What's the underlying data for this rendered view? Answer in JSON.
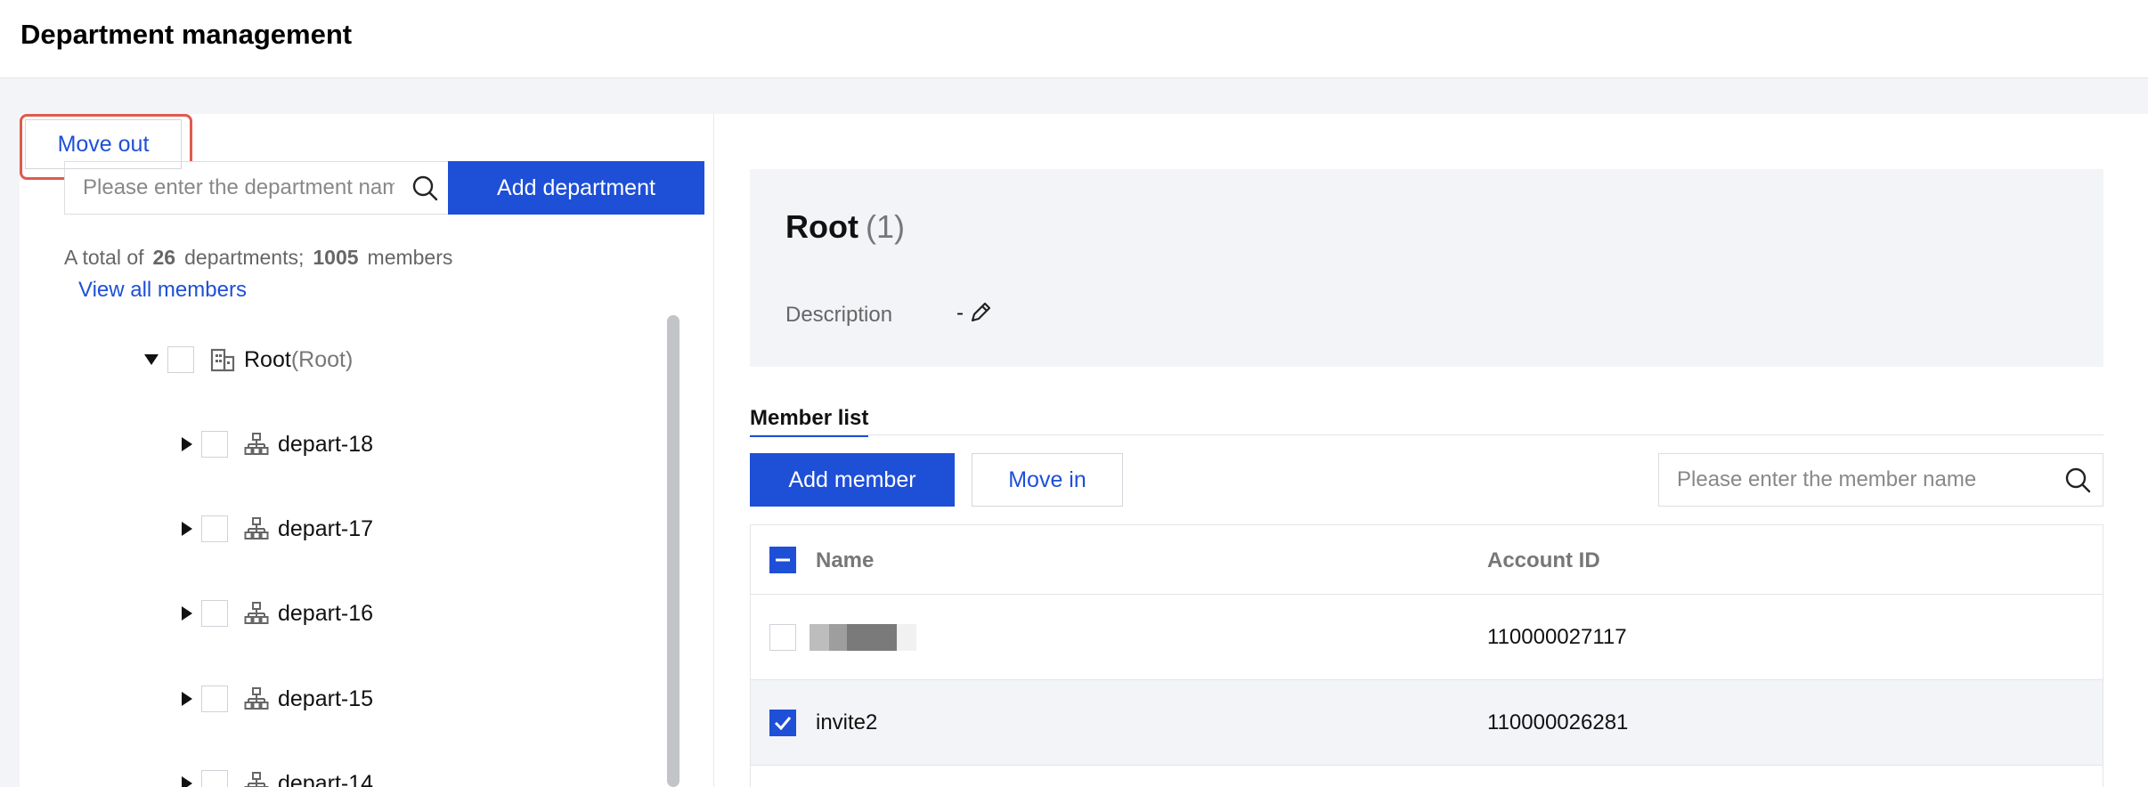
{
  "header": {
    "title": "Department management"
  },
  "left": {
    "search_placeholder": "Please enter the department name",
    "add_department_label": "Add department",
    "stats": {
      "prefix": "A total of",
      "department_count": "26",
      "departments_word": "departments;",
      "member_count": "1005",
      "members_word": "members"
    },
    "view_all_label": "View all members",
    "tree": {
      "root": {
        "label": "Root",
        "sub": "(Root)"
      },
      "children": [
        "depart-18",
        "depart-17",
        "depart-16",
        "depart-15",
        "depart-14"
      ]
    }
  },
  "right": {
    "department": {
      "name": "Root",
      "count": "(1)",
      "description_label": "Description",
      "description_value": "-"
    },
    "tab_label": "Member list",
    "buttons": {
      "add_member": "Add member",
      "move_in": "Move in",
      "move_out": "Move out"
    },
    "member_search_placeholder": "Please enter the member name",
    "table": {
      "columns": [
        "Name",
        "Account ID"
      ],
      "rows": [
        {
          "name": "",
          "account_id": "110000027117",
          "checked": false
        },
        {
          "name": "invite2",
          "account_id": "110000026281",
          "checked": true
        }
      ]
    }
  },
  "colors": {
    "primary": "#1e4fd7",
    "highlight": "#e05a4e"
  }
}
